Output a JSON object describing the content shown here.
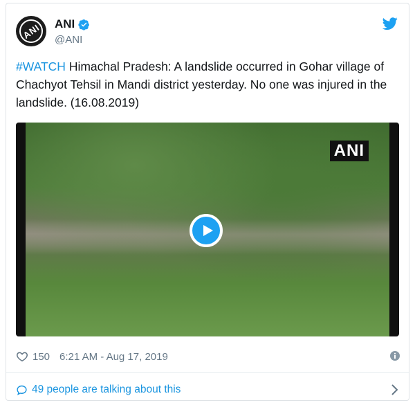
{
  "author": {
    "display_name": "ANI",
    "handle": "@ANI",
    "avatar_text": "ANI",
    "verified": true
  },
  "tweet": {
    "hashtag": "#WATCH",
    "body": " Himachal Pradesh: A landslide occurred in Gohar village of Chachyot Tehsil in Mandi district yesterday. No one was injured in the landslide. (16.08.2019)"
  },
  "media": {
    "watermark": "ANI",
    "play_icon": "play-icon"
  },
  "meta": {
    "likes": "150",
    "timestamp": "6:21 AM - Aug 17, 2019"
  },
  "conversation": {
    "label": "49 people are talking about this"
  },
  "colors": {
    "accent": "#1b95e0",
    "secondary_text": "#657786",
    "primary_text": "#14171a"
  },
  "icons": [
    "twitter-bird-icon",
    "verified-icon",
    "heart-icon",
    "info-icon",
    "speech-bubble-icon",
    "chevron-right-icon"
  ]
}
